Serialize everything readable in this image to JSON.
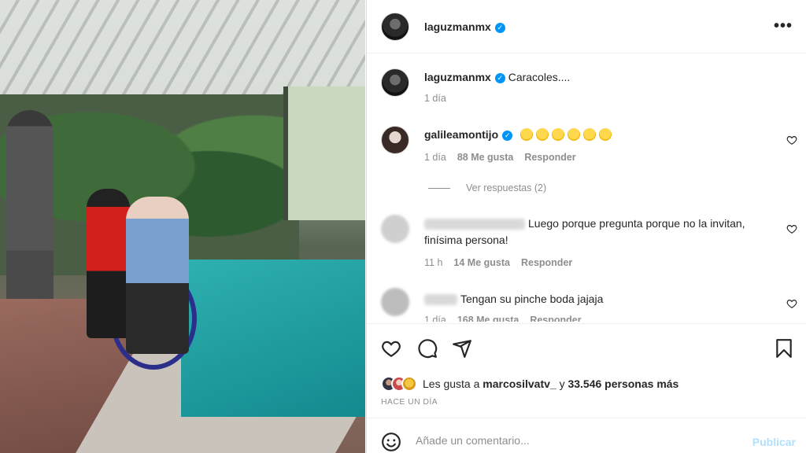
{
  "post": {
    "author": "laguzmanmx",
    "verified_mark": "✓"
  },
  "caption": {
    "author": "laguzmanmx",
    "text": "Caracoles....",
    "time": "1 día"
  },
  "comments": [
    {
      "author": "galileamontijo",
      "text": "",
      "emoji_count": 6,
      "time": "1 día",
      "likes": "88 Me gusta",
      "reply": "Responder",
      "view_replies": "Ver respuestas (2)"
    },
    {
      "author": "",
      "text": "Luego porque pregunta porque no la invitan, finísima persona!",
      "time": "11 h",
      "likes": "14 Me gusta",
      "reply": "Responder"
    },
    {
      "author": "",
      "text": "Tengan su pinche boda jajaja",
      "time": "1 día",
      "likes": "168 Me gusta",
      "reply": "Responder"
    }
  ],
  "likes_line": {
    "prefix": "Les gusta a",
    "user": "marcosilvatv_",
    "connector": "y",
    "others": "33.546 personas más"
  },
  "time_ago": "HACE UN DÍA",
  "add_comment": {
    "placeholder": "Añade un comentario...",
    "publish": "Publicar"
  },
  "icons": {
    "more": "more-options-icon",
    "like": "heart-icon",
    "comment": "comment-icon",
    "share": "send-icon",
    "save": "bookmark-icon",
    "emoji": "smiley-icon"
  },
  "colors": {
    "verified": "#0095f6",
    "muted": "#8e8e8e",
    "publish_disabled": "#b2dffc"
  }
}
